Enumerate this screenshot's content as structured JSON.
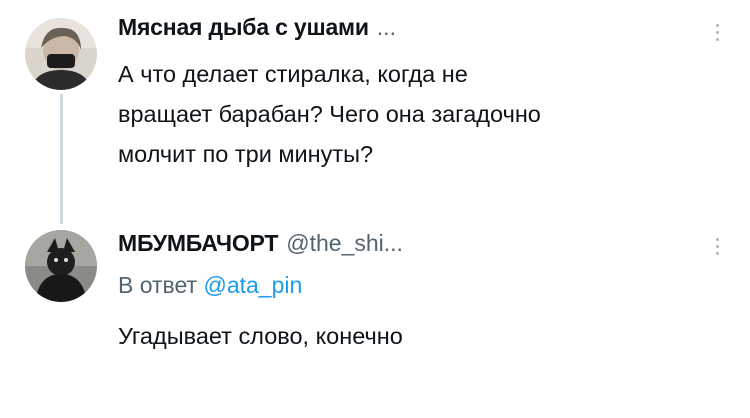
{
  "tweet1": {
    "name": "Мясная дыба с ушами",
    "ellipsis": "...",
    "text_line1": "А что делает стиралка, когда не",
    "text_line2": "вращает барабан? Чего она загадочно",
    "text_line3": "молчит по три минуты?",
    "avatar_icon": "user-avatar-masked-person"
  },
  "tweet2": {
    "name": "МБУМБАЧОРТ",
    "handle": "@the_shi...",
    "reply_prefix": "В ответ",
    "reply_mention": "@ata_pin",
    "text": "Угадывает слово, конечно",
    "avatar_icon": "user-avatar-dark-figure"
  },
  "colors": {
    "text": "#0f1419",
    "secondary": "#536471",
    "link": "#1d9bf0",
    "thread_line": "#cfd9de"
  }
}
